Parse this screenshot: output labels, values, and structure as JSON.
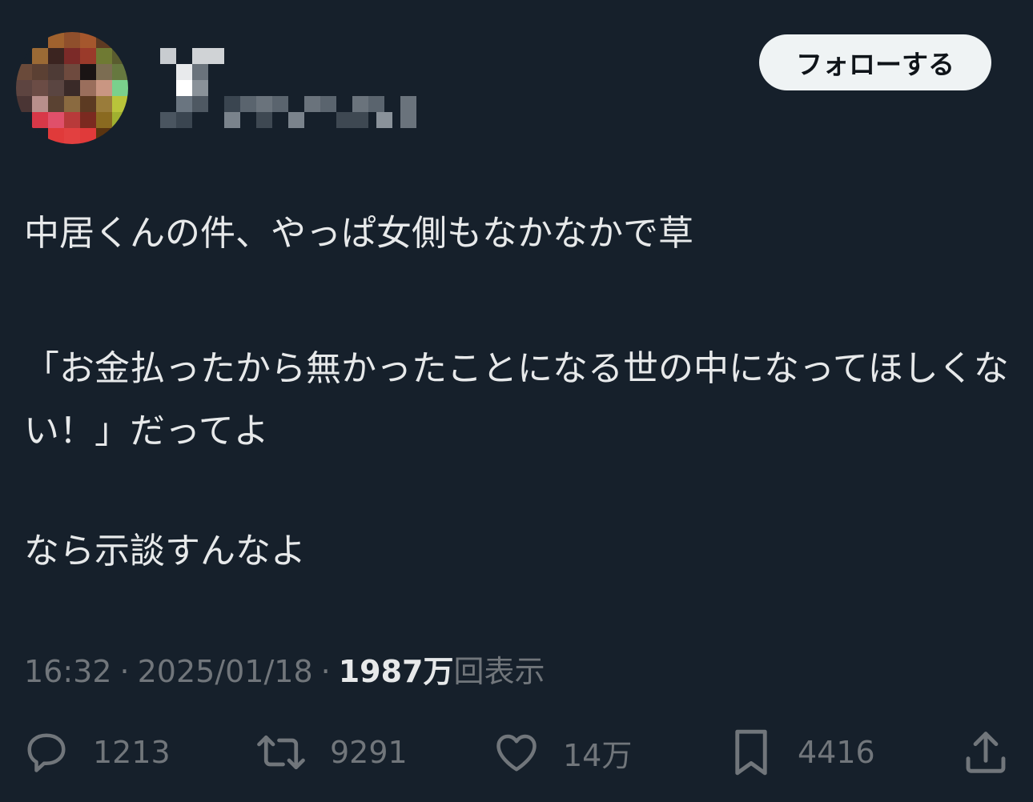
{
  "tweet": {
    "author_avatar_icon": "pixelated-avatar",
    "author_display_name": "",
    "author_handle": "",
    "follow_label": "フォローする",
    "body": {
      "line1": "中居くんの件、やっぱ女側もなかなかで草",
      "line2": "「お金払ったから無かったことになる世の中になってほしくない！」だってよ",
      "line3": "なら示談すんなよ"
    },
    "time": "16:32",
    "date": "2025/01/18",
    "separator": "·",
    "views_count": "1987万",
    "views_label": "回表示",
    "actions": {
      "reply": {
        "icon": "reply-icon",
        "count": "1213"
      },
      "retweet": {
        "icon": "retweet-icon",
        "count": "9291"
      },
      "like": {
        "icon": "heart-icon",
        "count": "14万"
      },
      "bookmark": {
        "icon": "bookmark-icon",
        "count": "4416"
      },
      "share": {
        "icon": "share-icon"
      }
    },
    "colors": {
      "background": "#16202b",
      "text": "#e7e9ea",
      "muted": "#71767b",
      "button_bg": "#eff3f4",
      "button_text": "#0f1419"
    }
  }
}
